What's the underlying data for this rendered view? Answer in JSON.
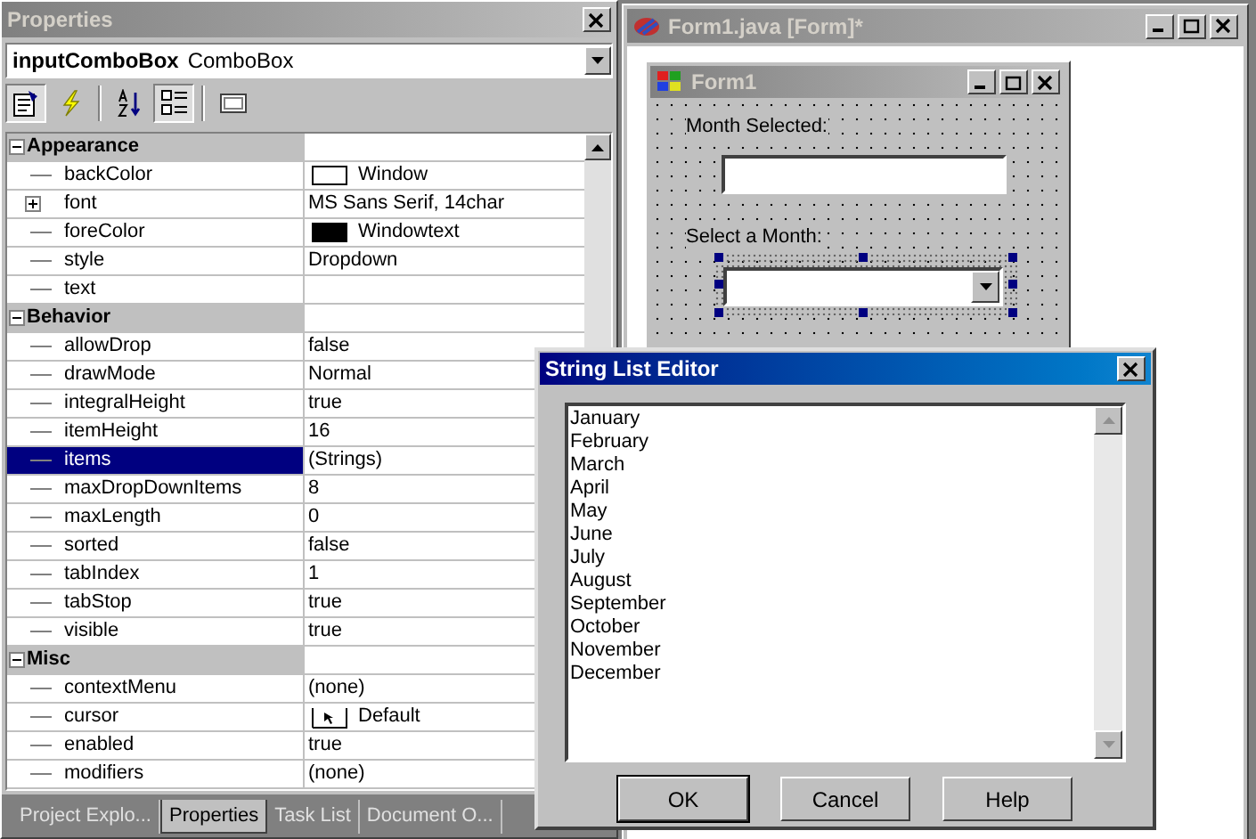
{
  "properties_panel": {
    "title": "Properties",
    "object_name": "inputComboBox",
    "object_type": "ComboBox",
    "toolbar": [
      {
        "kind": "pages",
        "selected": true
      },
      {
        "kind": "events",
        "selected": false
      },
      {
        "kind": "alphabetic",
        "selected": false
      },
      {
        "kind": "categorized",
        "selected": true
      },
      {
        "kind": "page",
        "selected": false
      }
    ],
    "categories": [
      {
        "name": "Appearance",
        "expanded": true,
        "rows": [
          {
            "name": "backColor",
            "value": "Window",
            "kind": "color",
            "color": "#ffffff",
            "selected": false
          },
          {
            "name": "font",
            "value": "MS Sans Serif, 14char",
            "kind": "expandable",
            "expanded": false,
            "selected": false
          },
          {
            "name": "foreColor",
            "value": "Windowtext",
            "kind": "color",
            "color": "#000000",
            "selected": false
          },
          {
            "name": "style",
            "value": "Dropdown",
            "kind": "text",
            "selected": false
          },
          {
            "name": "text",
            "value": "",
            "kind": "text",
            "selected": false
          }
        ]
      },
      {
        "name": "Behavior",
        "expanded": true,
        "rows": [
          {
            "name": "allowDrop",
            "value": "false",
            "kind": "text",
            "selected": false
          },
          {
            "name": "drawMode",
            "value": "Normal",
            "kind": "text",
            "selected": false
          },
          {
            "name": "integralHeight",
            "value": "true",
            "kind": "text",
            "selected": false
          },
          {
            "name": "itemHeight",
            "value": "16",
            "kind": "text",
            "selected": false
          },
          {
            "name": "items",
            "value": "(Strings)",
            "kind": "text",
            "selected": true
          },
          {
            "name": "maxDropDownItems",
            "value": "8",
            "kind": "text",
            "selected": false
          },
          {
            "name": "maxLength",
            "value": "0",
            "kind": "text",
            "selected": false
          },
          {
            "name": "sorted",
            "value": "false",
            "kind": "text",
            "selected": false
          },
          {
            "name": "tabIndex",
            "value": "1",
            "kind": "text",
            "selected": false
          },
          {
            "name": "tabStop",
            "value": "true",
            "kind": "text",
            "selected": false
          },
          {
            "name": "visible",
            "value": "true",
            "kind": "text",
            "selected": false
          }
        ]
      },
      {
        "name": "Misc",
        "expanded": true,
        "rows": [
          {
            "name": "contextMenu",
            "value": "(none)",
            "kind": "text",
            "selected": false
          },
          {
            "name": "cursor",
            "value": "Default",
            "kind": "cursor",
            "selected": false
          },
          {
            "name": "enabled",
            "value": "true",
            "kind": "text",
            "selected": false
          },
          {
            "name": "modifiers",
            "value": "(none)",
            "kind": "text",
            "selected": false
          }
        ]
      }
    ],
    "tabs": [
      {
        "label": "Project Explo...",
        "selected": false
      },
      {
        "label": "Properties",
        "selected": true
      },
      {
        "label": "Task List",
        "selected": false
      },
      {
        "label": "Document O...",
        "selected": false
      }
    ]
  },
  "designer_window": {
    "title": "Form1.java [Form]*",
    "active": false,
    "form": {
      "title": "Form1",
      "active": false,
      "label_1": "Month Selected:",
      "label_2": "Select a Month:",
      "combo_selected": true
    }
  },
  "dialog": {
    "title": "String List Editor",
    "active": true,
    "items": [
      "January",
      "February",
      "March",
      "April",
      "May",
      "June",
      "July",
      "August",
      "September",
      "October",
      "November",
      "December"
    ],
    "buttons": [
      {
        "label": "OK",
        "default": true
      },
      {
        "label": "Cancel",
        "default": false
      },
      {
        "label": "Help",
        "default": false
      }
    ]
  }
}
